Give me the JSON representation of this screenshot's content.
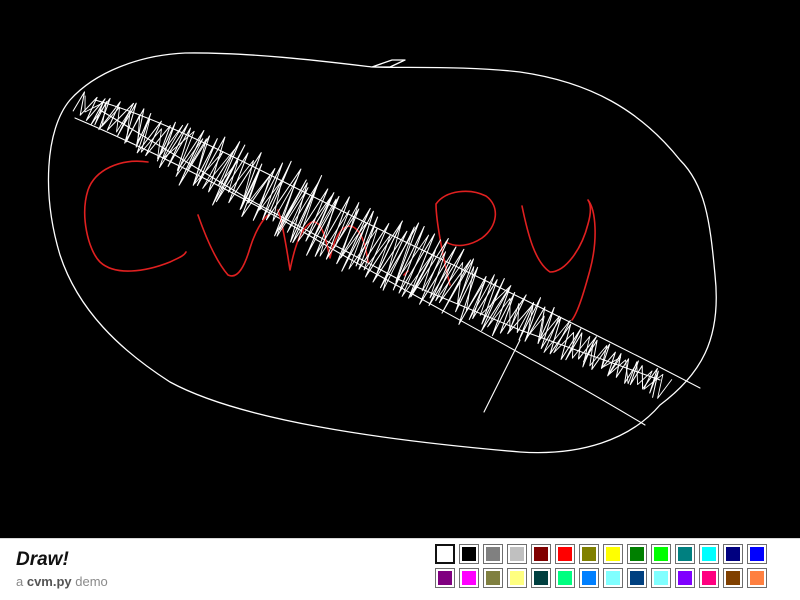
{
  "app": {
    "title": "Draw!",
    "subtitle_prefix": "a ",
    "subtitle_lib": "cvm.py",
    "subtitle_suffix": " demo"
  },
  "canvas": {
    "background": "#000000",
    "stroke_colors": {
      "white": "#ffffff",
      "red": "#e02020"
    }
  },
  "palette": {
    "selected": "#ffffff",
    "colors": [
      "#ffffff",
      "#000000",
      "#808080",
      "#c0c0c0",
      "#800000",
      "#ff0000",
      "#808000",
      "#ffff00",
      "#008000",
      "#00ff00",
      "#008080",
      "#00ffff",
      "#000080",
      "#0000ff",
      "#800080",
      "#ff00ff",
      "#808040",
      "#ffff80",
      "#004040",
      "#00ff80",
      "#0080ff",
      "#80ffff",
      "#004080",
      "#80ffff",
      "#8000ff",
      "#ff0080",
      "#804000",
      "#ff8040"
    ]
  }
}
